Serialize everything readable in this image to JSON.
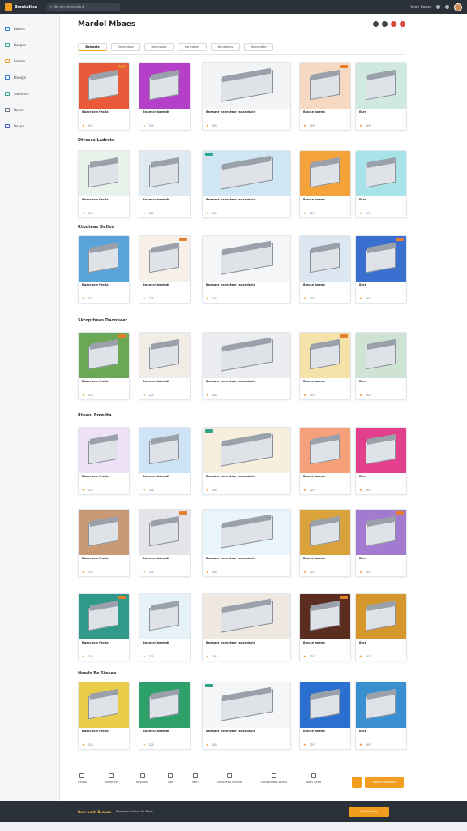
{
  "topbar": {
    "logo": "Bwetalina",
    "search_placeholder": "Be der ehotedlant",
    "links": [
      "Kewtl Bwaae"
    ]
  },
  "sidebar": [
    {
      "label": "Batnes",
      "icon": "grid-icon",
      "color": "#2b7bd8"
    },
    {
      "label": "Doxpes",
      "icon": "cart-icon",
      "color": "#2ea48b"
    },
    {
      "label": "Rooteb",
      "icon": "tag-icon",
      "color": "#f29d1e"
    },
    {
      "label": "Daexps",
      "icon": "chart-icon",
      "color": "#2b7bd8"
    },
    {
      "label": "Saoerens",
      "icon": "stack-icon",
      "color": "#2ea48b"
    },
    {
      "label": "Dasen",
      "icon": "gear-icon",
      "color": "#6a727d"
    },
    {
      "label": "Dexps",
      "icon": "folder-icon",
      "color": "#4a56c8"
    }
  ],
  "main": {
    "title": "Mardol Mbaes",
    "tabs": [
      "Baleoats",
      "Baneedshe",
      "Beninotars",
      "Baneatses",
      "Banetaoes",
      "Baneedbte"
    ],
    "sections": [
      "Dtresas Ladreta",
      "Rtooteas Dalled",
      "Sktoprbees Daonbeet",
      "Rteeol Bmedta",
      "Hoeds Be Stesea"
    ],
    "card_titles": [
      "Buacrnaw feoda",
      "Bnaescr boeeldf",
      "Bnesanr bseestsar tsoandsoir",
      "Blacse boena",
      "Bsre"
    ],
    "card_meta": [
      "205",
      "225",
      "286",
      "325",
      "345"
    ]
  },
  "footer": {
    "nav": [
      "Ratkal",
      "Baneate",
      "Besoden",
      "Tatk",
      "Taeh",
      "Snaaceba Bteose",
      "Srestaredba Beaso",
      "Boes Beoa"
    ],
    "cta": "Bsoed bessbted"
  },
  "bottombar": {
    "left": "Bosr anetl Beaues",
    "mid": "Bresmobs Bdeod tht Beob",
    "button": "Bssr bsoeda"
  }
}
